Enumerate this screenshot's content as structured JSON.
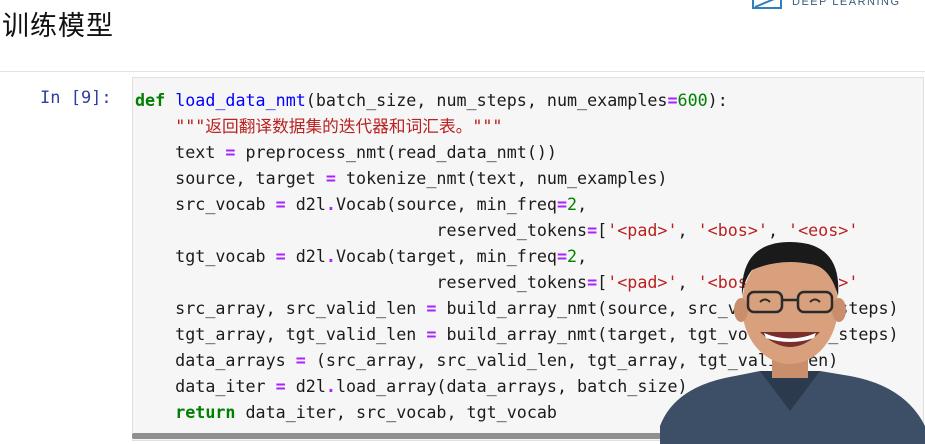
{
  "title": "训练模型",
  "logo": {
    "text": "DEEP LEARNING"
  },
  "cell": {
    "prompt": "In [9]:",
    "lines": [
      [
        {
          "t": "def",
          "c": "kw"
        },
        {
          "t": " "
        },
        {
          "t": "load_data_nmt",
          "c": "fn"
        },
        {
          "t": "(batch_size, num_steps, num_examples"
        },
        {
          "t": "=",
          "c": "op"
        },
        {
          "t": "600",
          "c": "num"
        },
        {
          "t": "):"
        }
      ],
      [
        {
          "t": "    "
        },
        {
          "t": "\"\"\"返回翻译数据集的迭代器和词汇表。\"\"\"",
          "c": "str"
        }
      ],
      [
        {
          "t": "    text "
        },
        {
          "t": "=",
          "c": "op"
        },
        {
          "t": " preprocess_nmt(read_data_nmt())"
        }
      ],
      [
        {
          "t": "    source, target "
        },
        {
          "t": "=",
          "c": "op"
        },
        {
          "t": " tokenize_nmt(text, num_examples)"
        }
      ],
      [
        {
          "t": "    src_vocab "
        },
        {
          "t": "=",
          "c": "op"
        },
        {
          "t": " d2l"
        },
        {
          "t": ".",
          "c": "op"
        },
        {
          "t": "Vocab(source, min_freq"
        },
        {
          "t": "=",
          "c": "op"
        },
        {
          "t": "2",
          "c": "num"
        },
        {
          "t": ","
        }
      ],
      [
        {
          "t": "                              reserved_tokens"
        },
        {
          "t": "=",
          "c": "op"
        },
        {
          "t": "["
        },
        {
          "t": "'<pad>'",
          "c": "str"
        },
        {
          "t": ", "
        },
        {
          "t": "'<bos>'",
          "c": "str"
        },
        {
          "t": ", "
        },
        {
          "t": "'<eos>'",
          "c": "str"
        }
      ],
      [
        {
          "t": "    tgt_vocab "
        },
        {
          "t": "=",
          "c": "op"
        },
        {
          "t": " d2l"
        },
        {
          "t": ".",
          "c": "op"
        },
        {
          "t": "Vocab(target, min_freq"
        },
        {
          "t": "=",
          "c": "op"
        },
        {
          "t": "2",
          "c": "num"
        },
        {
          "t": ","
        }
      ],
      [
        {
          "t": "                              reserved_tokens"
        },
        {
          "t": "=",
          "c": "op"
        },
        {
          "t": "["
        },
        {
          "t": "'<pad>'",
          "c": "str"
        },
        {
          "t": ", "
        },
        {
          "t": "'<bos>'",
          "c": "str"
        },
        {
          "t": ", "
        },
        {
          "t": "'<eos>'",
          "c": "str"
        }
      ],
      [
        {
          "t": "    src_array, src_valid_len "
        },
        {
          "t": "=",
          "c": "op"
        },
        {
          "t": " build_array_nmt(source, src_vocab, num_steps)"
        }
      ],
      [
        {
          "t": "    tgt_array, tgt_valid_len "
        },
        {
          "t": "=",
          "c": "op"
        },
        {
          "t": " build_array_nmt(target, tgt_vocab, num_steps)"
        }
      ],
      [
        {
          "t": "    data_arrays "
        },
        {
          "t": "=",
          "c": "op"
        },
        {
          "t": " (src_array, src_valid_len, tgt_array, tgt_valid_len)"
        }
      ],
      [
        {
          "t": "    data_iter "
        },
        {
          "t": "=",
          "c": "op"
        },
        {
          "t": " d2l"
        },
        {
          "t": ".",
          "c": "op"
        },
        {
          "t": "load_array(data_arrays, batch_size)"
        }
      ],
      [
        {
          "t": "    "
        },
        {
          "t": "return",
          "c": "kw"
        },
        {
          "t": " data_iter, src_vocab, tgt_vocab"
        }
      ]
    ]
  },
  "colors": {
    "background": "#ffffff",
    "cell_bg": "#f6f6f6",
    "prompt": "#303f9f",
    "keyword": "#008000",
    "function_name": "#0000ff",
    "operator": "#aa22ff",
    "string": "#ba2121"
  },
  "scrollbar": {
    "position": 0.88
  }
}
